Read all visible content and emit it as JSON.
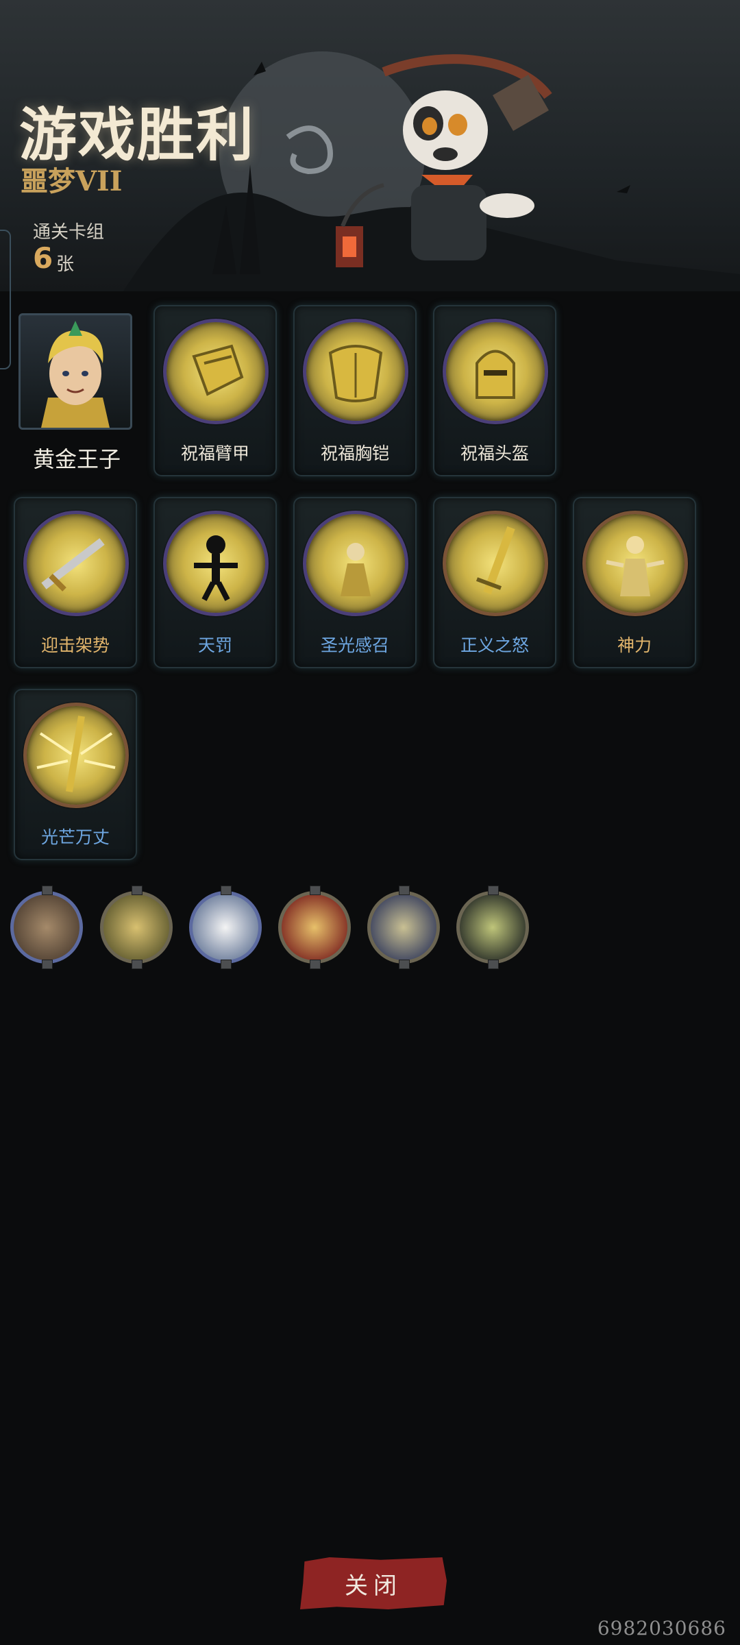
{
  "header": {
    "title": "游戏胜利",
    "subtitle": "噩梦VII",
    "deck_label": "通关卡组",
    "deck_count": "6",
    "deck_unit": "张"
  },
  "hero": {
    "name": "黄金王子"
  },
  "cards": [
    {
      "label": "祝福臂甲",
      "color": "white",
      "ring": "purple",
      "icon": "blessed-armguard-icon"
    },
    {
      "label": "祝福胸铠",
      "color": "white",
      "ring": "purple",
      "icon": "blessed-breastplate-icon"
    },
    {
      "label": "祝福头盔",
      "color": "white",
      "ring": "purple",
      "icon": "blessed-helmet-icon"
    },
    {
      "label": "迎击架势",
      "color": "gold",
      "ring": "purple",
      "icon": "counter-stance-sword-icon"
    },
    {
      "label": "天罚",
      "color": "blue",
      "ring": "purple",
      "icon": "divine-punishment-skeleton-icon"
    },
    {
      "label": "圣光感召",
      "color": "blue",
      "ring": "purple",
      "icon": "holy-light-summon-icon"
    },
    {
      "label": "正义之怒",
      "color": "blue",
      "ring": "bronze",
      "icon": "righteous-fury-sword-icon"
    },
    {
      "label": "神力",
      "color": "gold",
      "ring": "bronze",
      "icon": "divine-power-figure-icon"
    },
    {
      "label": "光芒万丈",
      "color": "blue",
      "ring": "bronze",
      "icon": "radiant-sword-icon"
    }
  ],
  "companions": [
    {
      "name": "raccoon-portrait",
      "ring": "#5c6aa0"
    },
    {
      "name": "golden-knight-portrait",
      "ring": "#6b6552"
    },
    {
      "name": "white-cat-portrait",
      "ring": "#5c6aa0"
    },
    {
      "name": "warrior-portrait",
      "ring": "#6b6552"
    },
    {
      "name": "hooded-ranger-portrait",
      "ring": "#6b6552"
    },
    {
      "name": "dark-scene-portrait",
      "ring": "#6b6552"
    }
  ],
  "footer": {
    "close_label": "关闭",
    "watermark": "6982030686"
  },
  "colors": {
    "accent_gold": "#d9a95e",
    "close_red": "#8e2423",
    "label_blue": "#6ea7e2"
  }
}
